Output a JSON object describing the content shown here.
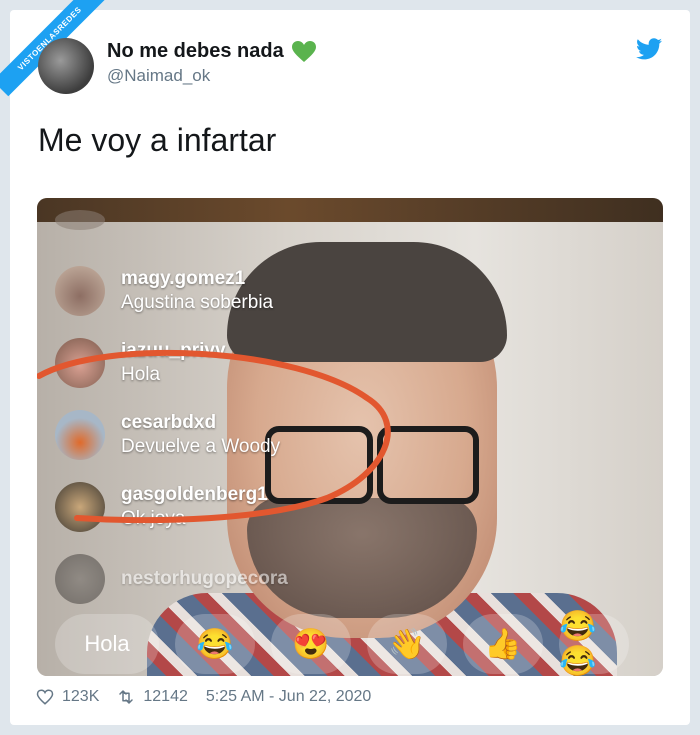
{
  "ribbon": "VISTOENLASREDES",
  "author": {
    "name": "No me debes nada",
    "handle": "@Naimad_ok"
  },
  "tweet_text": "Me voy a infartar",
  "colors": {
    "brand": "#1da1f2",
    "heart": "#5ab34e",
    "annotation": "#e2572f"
  },
  "media": {
    "comments": [
      {
        "user": "",
        "text": ""
      },
      {
        "user": "magy.gomez1",
        "text": "Agustina soberbia"
      },
      {
        "user": "iazuu_privv",
        "text": "Hola"
      },
      {
        "user": "cesarbdxd",
        "text": "Devuelve a Woody"
      },
      {
        "user": "gasgoldenberg1",
        "text": "Ok joya"
      },
      {
        "user": "nestorhugopecora",
        "text": ""
      }
    ],
    "quick_replies": [
      "Hola",
      "😂",
      "😍",
      "👋",
      "👍",
      "😂😂"
    ]
  },
  "stats": {
    "likes": "123K",
    "retweets": "12142",
    "timestamp": "5:25 AM - Jun 22, 2020"
  }
}
